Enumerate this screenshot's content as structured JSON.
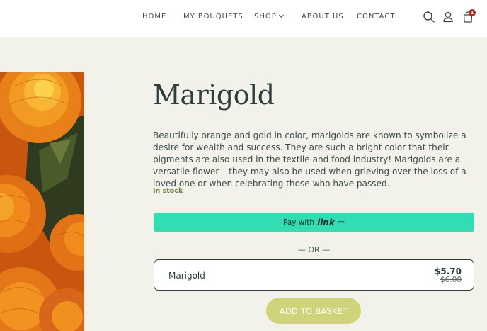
{
  "nav": {
    "items": [
      {
        "label": "HOME"
      },
      {
        "label": "MY BOUQUETS"
      },
      {
        "label": "SHOP"
      },
      {
        "label": "ABOUT US"
      },
      {
        "label": "CONTACT"
      }
    ],
    "cart_count": "1"
  },
  "product": {
    "title": "Marigold",
    "description": "Beautifully orange and gold in color, marigolds are known to symbolize a desire for wealth and success. They are such a bright color that their pigments are also used in the textile and food industry! Marigolds are a versatile flower – they may also be used when grieving over the loss of a loved one or when celebrating those who have passed.",
    "stock": "In stock",
    "pay_label": "Pay with",
    "pay_brand": "link",
    "or_text": "— OR —",
    "variant": {
      "name": "Marigold",
      "price": "$5.70",
      "old_price": "$6.00"
    },
    "add_label": "ADD TO BASKET"
  },
  "colors": {
    "pay_button": "#33ddb3",
    "add_button": "#cfd47a",
    "stock_text": "#6b7d3c",
    "cart_badge": "#b3261e"
  },
  "icons": {
    "search": "search-icon",
    "account": "account-icon",
    "cart": "shopping-bag-icon"
  }
}
